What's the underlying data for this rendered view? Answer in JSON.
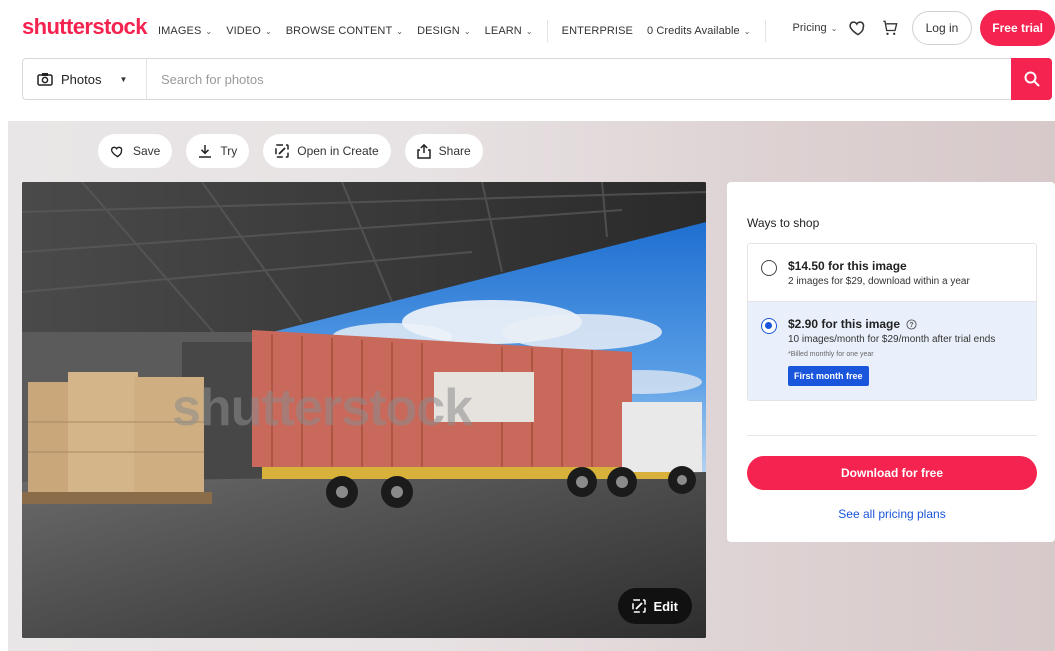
{
  "brand": {
    "logo": "shutterstock",
    "accent": "#f5234f",
    "link": "#1a56db"
  },
  "nav": {
    "items": [
      {
        "label": "IMAGES",
        "dropdown": true
      },
      {
        "label": "VIDEO",
        "dropdown": true
      },
      {
        "label": "BROWSE CONTENT",
        "dropdown": true
      },
      {
        "label": "DESIGN",
        "dropdown": true
      },
      {
        "label": "LEARN",
        "dropdown": true
      }
    ],
    "enterprise": "ENTERPRISE",
    "credits": "0 Credits Available",
    "pricing": "Pricing",
    "login": "Log in",
    "free_trial": "Free trial"
  },
  "search": {
    "type": "Photos",
    "placeholder": "Search for photos"
  },
  "actions": {
    "save": "Save",
    "try": "Try",
    "open_in_create": "Open in Create",
    "share": "Share"
  },
  "image": {
    "watermark": "shutterstock",
    "edit": "Edit"
  },
  "shop": {
    "title": "Ways to shop",
    "options": [
      {
        "price": "$14.50 for this image",
        "desc": "2 images for $29, download within a year",
        "selected": false
      },
      {
        "price": "$2.90 for this image",
        "desc": "10 images/month for $29/month after trial ends",
        "note": "*Billed monthly for one year",
        "badge": "First month free",
        "selected": true
      }
    ],
    "download": "Download for free",
    "pricing_link": "See all pricing plans"
  }
}
